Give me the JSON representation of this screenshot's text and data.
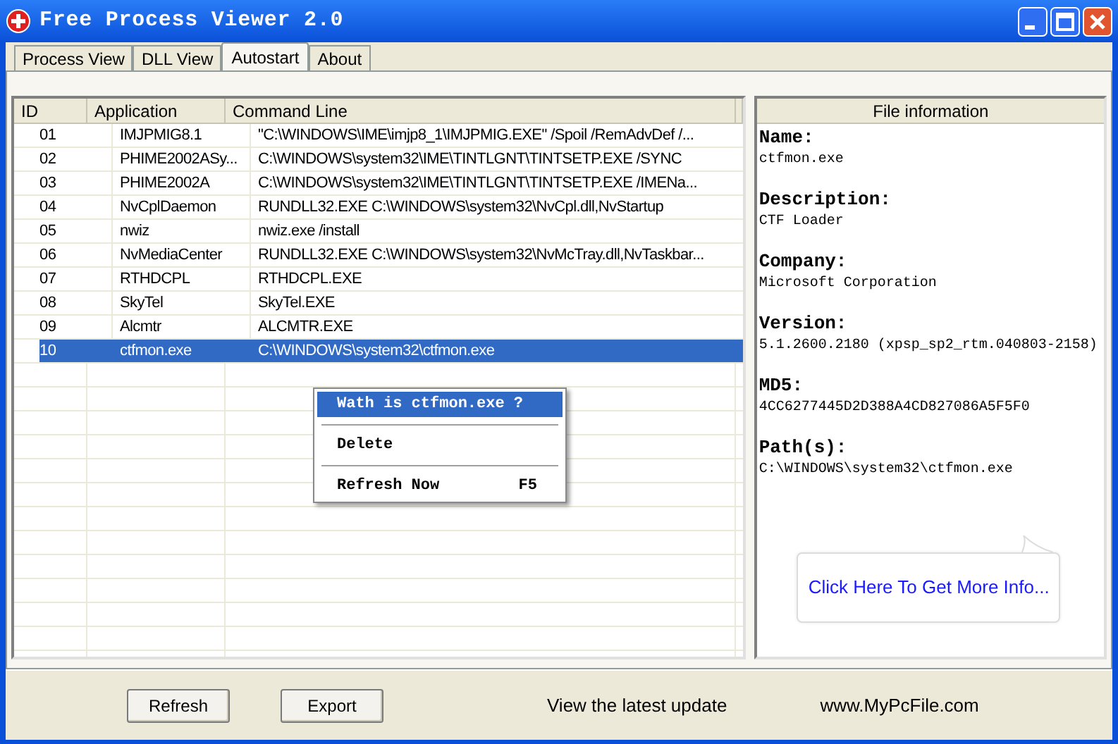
{
  "window": {
    "title": "Free Process Viewer 2.0"
  },
  "tabs": [
    {
      "label": "Process View",
      "selected": false
    },
    {
      "label": "DLL View",
      "selected": false
    },
    {
      "label": "Autostart",
      "selected": true
    },
    {
      "label": "About",
      "selected": false
    }
  ],
  "table": {
    "columns": [
      "ID",
      "Application",
      "Command Line"
    ],
    "rows": [
      {
        "id": "01",
        "application": "IMJPMIG8.1",
        "command_line": "\"C:\\WINDOWS\\IME\\imjp8_1\\IMJPMIG.EXE\" /Spoil /RemAdvDef /...",
        "selected": false
      },
      {
        "id": "02",
        "application": "PHIME2002ASy...",
        "command_line": "C:\\WINDOWS\\system32\\IME\\TINTLGNT\\TINTSETP.EXE /SYNC",
        "selected": false
      },
      {
        "id": "03",
        "application": "PHIME2002A",
        "command_line": "C:\\WINDOWS\\system32\\IME\\TINTLGNT\\TINTSETP.EXE /IMENa...",
        "selected": false
      },
      {
        "id": "04",
        "application": "NvCplDaemon",
        "command_line": "RUNDLL32.EXE C:\\WINDOWS\\system32\\NvCpl.dll,NvStartup",
        "selected": false
      },
      {
        "id": "05",
        "application": "nwiz",
        "command_line": "nwiz.exe /install",
        "selected": false
      },
      {
        "id": "06",
        "application": "NvMediaCenter",
        "command_line": "RUNDLL32.EXE C:\\WINDOWS\\system32\\NvMcTray.dll,NvTaskbar...",
        "selected": false
      },
      {
        "id": "07",
        "application": "RTHDCPL",
        "command_line": "RTHDCPL.EXE",
        "selected": false
      },
      {
        "id": "08",
        "application": "SkyTel",
        "command_line": "SkyTel.EXE",
        "selected": false
      },
      {
        "id": "09",
        "application": "Alcmtr",
        "command_line": "ALCMTR.EXE",
        "selected": false
      },
      {
        "id": "10",
        "application": "ctfmon.exe",
        "command_line": "C:\\WINDOWS\\system32\\ctfmon.exe",
        "selected": true
      }
    ]
  },
  "context_menu": {
    "items": [
      {
        "label": "Wath is ctfmon.exe ?",
        "selected": true
      },
      {
        "label": "Delete",
        "selected": false
      },
      {
        "label": "Refresh Now",
        "shortcut": "F5",
        "selected": false
      }
    ]
  },
  "file_information": {
    "title": "File information",
    "fields": [
      {
        "label": "Name:",
        "value": "ctfmon.exe"
      },
      {
        "label": "Description:",
        "value": "CTF Loader"
      },
      {
        "label": "Company:",
        "value": "Microsoft Corporation"
      },
      {
        "label": "Version:",
        "value": "5.1.2600.2180 (xpsp_sp2_rtm.040803-2158)"
      },
      {
        "label": "MD5:",
        "value": "4CC6277445D2D388A4CD827086A5F5F0"
      },
      {
        "label": "Path(s):",
        "value": "C:\\WINDOWS\\system32\\ctfmon.exe"
      }
    ],
    "link": "Click Here To Get More Info..."
  },
  "buttons": [
    "Refresh",
    "Export"
  ],
  "footer_links": [
    "View the latest update",
    "www.MyPcFile.com"
  ]
}
